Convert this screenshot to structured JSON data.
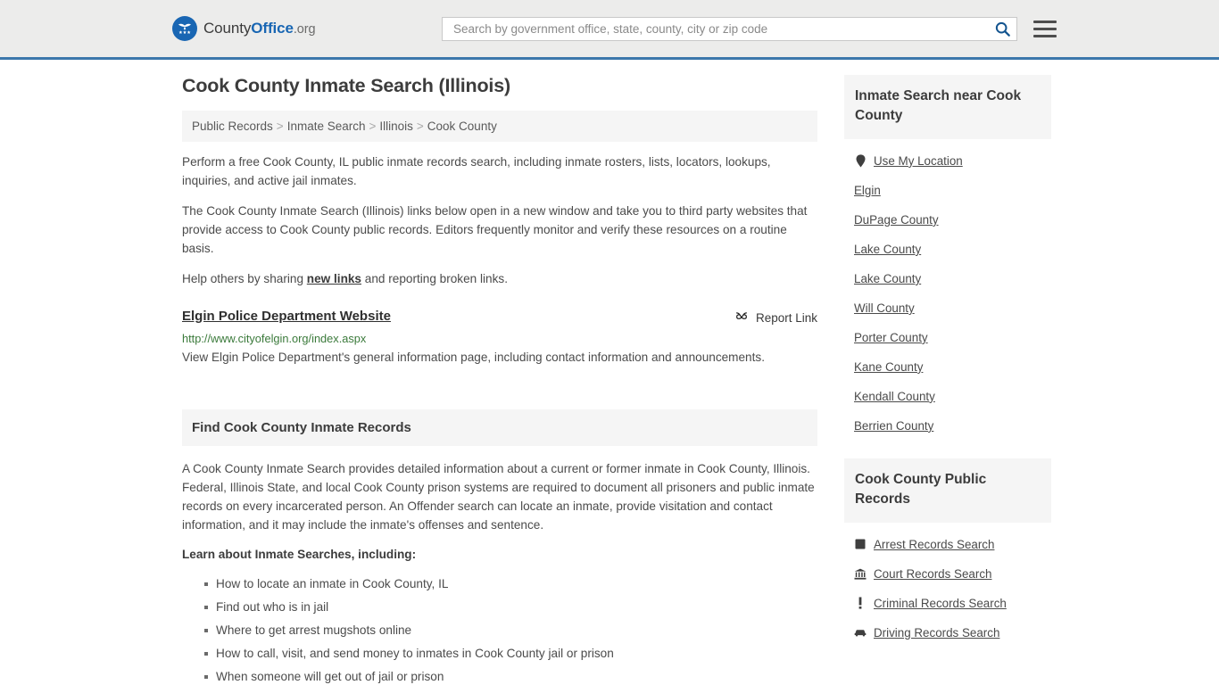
{
  "header": {
    "logo": {
      "icon": "eagle-shield-logo",
      "text_county": "County",
      "text_office": "Office",
      "text_org": ".org"
    },
    "search": {
      "placeholder": "Search by government office, state, county, city or zip code",
      "value": "",
      "search_icon": "search-icon",
      "menu_icon": "hamburger-menu-icon"
    },
    "accent_color": "#3c78ab",
    "background_color": "#ececeb"
  },
  "main": {
    "title": "Cook County Inmate Search (Illinois)",
    "breadcrumb": [
      "Public Records",
      "Inmate Search",
      "Illinois",
      "Cook County"
    ],
    "breadcrumb_separator": ">",
    "paragraphs": [
      "Perform a free Cook County, IL public inmate records search, including inmate rosters, lists, locators, lookups, inquiries, and active jail inmates.",
      "The Cook County Inmate Search (Illinois) links below open in a new window and take you to third party websites that provide access to Cook County public records. Editors frequently monitor and verify these resources on a routine basis."
    ],
    "share_prefix": "Help others by sharing ",
    "share_link": "new links",
    "share_suffix": " and reporting broken links.",
    "result": {
      "title": "Elgin Police Department Website",
      "url": "http://www.cityofelgin.org/index.aspx",
      "description": "View Elgin Police Department's general information page, including contact information and announcements.",
      "report_label": "Report Link",
      "report_icon": "broken-link-icon"
    },
    "section": {
      "heading": "Find Cook County Inmate Records",
      "body": "A Cook County Inmate Search provides detailed information about a current or former inmate in Cook County, Illinois. Federal, Illinois State, and local Cook County prison systems are required to document all prisoners and public inmate records on every incarcerated person. An Offender search can locate an inmate, provide visitation and contact information, and it may include the inmate's offenses and sentence.",
      "lead_in": "Learn about Inmate Searches, including:",
      "bullets": [
        "How to locate an inmate in Cook County, IL",
        "Find out who is in jail",
        "Where to get arrest mugshots online",
        "How to call, visit, and send money to inmates in Cook County jail or prison",
        "When someone will get out of jail or prison"
      ]
    }
  },
  "sidebar": {
    "nearby": {
      "heading": "Inmate Search near Cook County",
      "items": [
        {
          "label": "Use My Location",
          "icon": "map-pin-icon"
        },
        {
          "label": "Elgin",
          "icon": ""
        },
        {
          "label": "DuPage County",
          "icon": ""
        },
        {
          "label": "Lake County",
          "icon": ""
        },
        {
          "label": "Lake County",
          "icon": ""
        },
        {
          "label": "Will County",
          "icon": ""
        },
        {
          "label": "Porter County",
          "icon": ""
        },
        {
          "label": "Kane County",
          "icon": ""
        },
        {
          "label": "Kendall County",
          "icon": ""
        },
        {
          "label": "Berrien County",
          "icon": ""
        }
      ]
    },
    "public_records": {
      "heading": "Cook County Public Records",
      "items": [
        {
          "label": "Arrest Records Search",
          "icon": "fingerprint-square-icon"
        },
        {
          "label": "Court Records Search",
          "icon": "courthouse-icon"
        },
        {
          "label": "Criminal Records Search",
          "icon": "exclamation-icon"
        },
        {
          "label": "Driving Records Search",
          "icon": "car-icon"
        }
      ]
    }
  }
}
